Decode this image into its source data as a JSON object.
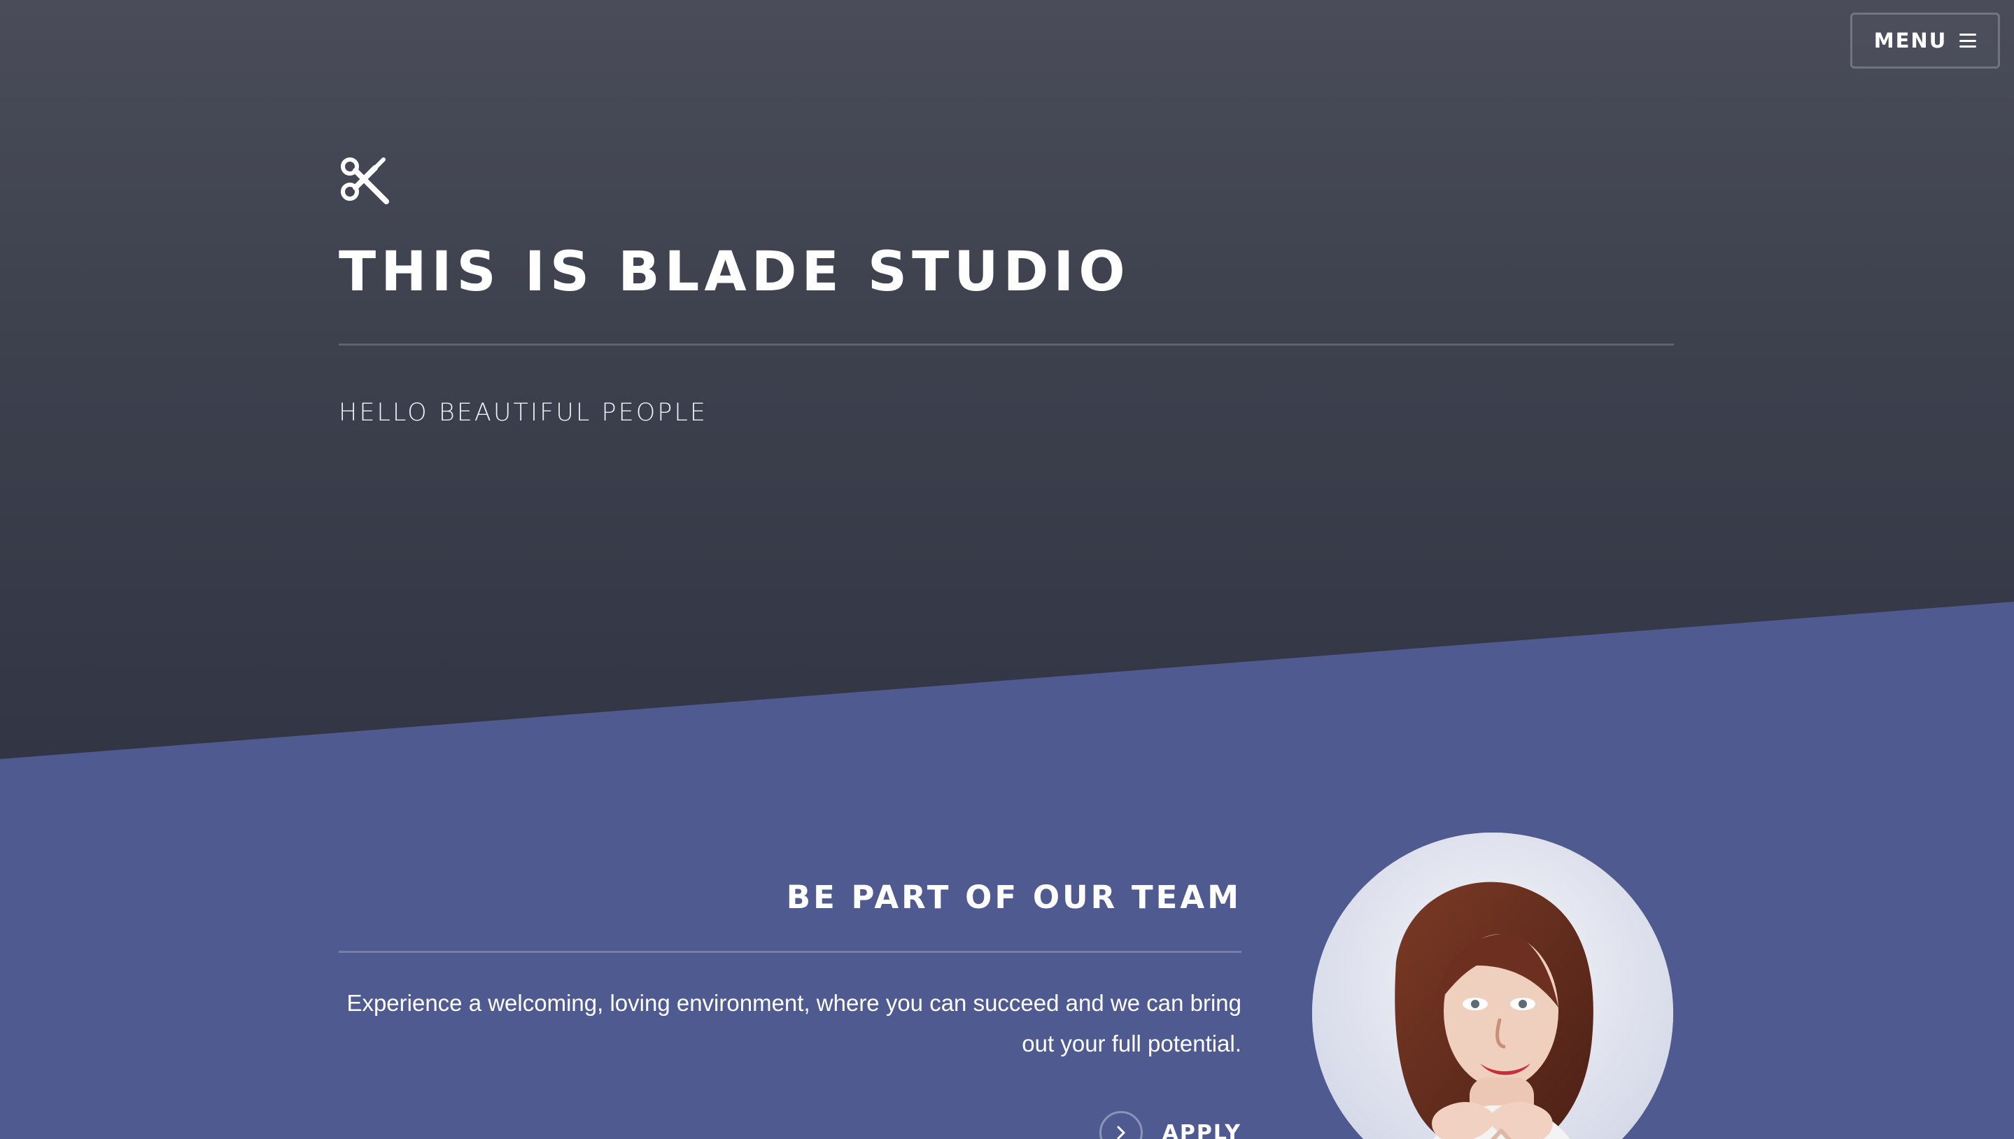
{
  "header": {
    "menu_label": "MENU",
    "menu_icon": "hamburger-menu-icon",
    "logo_icon": "scissors-icon"
  },
  "hero": {
    "title": "THIS IS BLADE STUDIO",
    "subtitle": "HELLO BEAUTIFUL PEOPLE",
    "background_top": "#4a4c5a",
    "background_bottom": "#323644"
  },
  "team": {
    "title": "BE PART OF OUR TEAM",
    "text": "Experience a welcoming, loving environment, where you can succeed and we can bring out your full potential.",
    "apply_label": "APPLY",
    "apply_icon": "chevron-right-icon",
    "background": "#4f5b90"
  }
}
